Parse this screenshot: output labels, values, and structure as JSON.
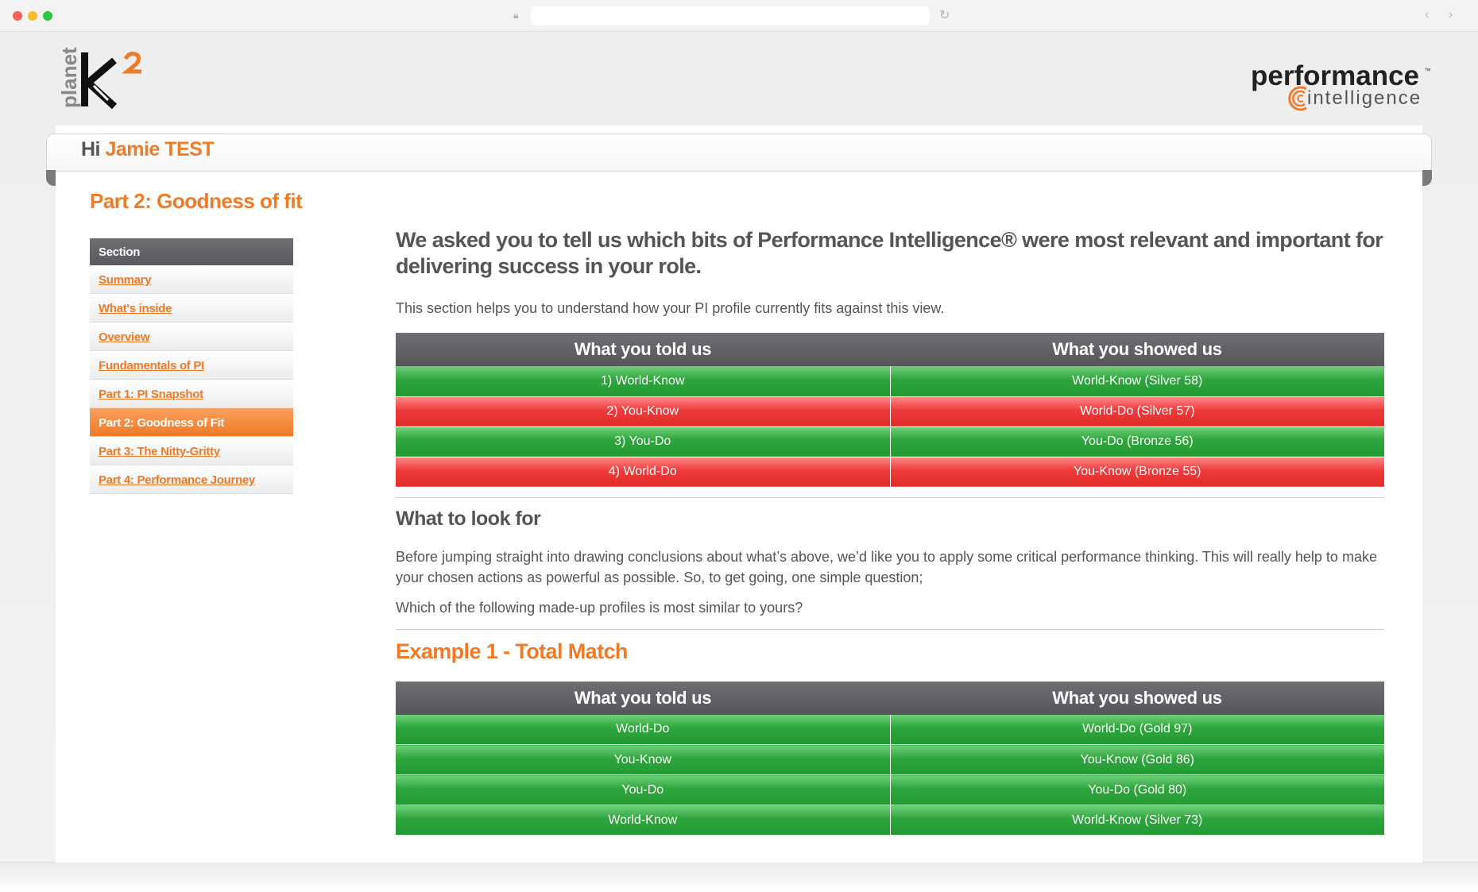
{
  "browser": {},
  "header": {
    "logo_text": "planet",
    "brand_right_1": "performance",
    "brand_right_tm": "™",
    "brand_right_2": "intelligence"
  },
  "greeting": {
    "hi": "Hi",
    "name": "Jamie TEST"
  },
  "page_title": "Part 2: Goodness of fit",
  "sidebar": {
    "heading": "Section",
    "items": [
      {
        "label": "Summary"
      },
      {
        "label": "What's inside"
      },
      {
        "label": "Overview"
      },
      {
        "label": "Fundamentals of PI"
      },
      {
        "label": "Part 1: PI Snapshot"
      },
      {
        "label": "Part 2: Goodness of Fit"
      },
      {
        "label": "Part 3: The Nitty-Gritty"
      },
      {
        "label": "Part 4: Performance Journey"
      }
    ],
    "active_index": 5
  },
  "main": {
    "lead": "We asked you to tell us which bits of Performance Intelligence® were most relevant and important for delivering success in your role.",
    "intro": "This section helps you to understand how your PI profile currently fits against this view.",
    "table1": {
      "col1": "What you told us",
      "col2": "What you showed us",
      "rows": [
        {
          "told": "1) World-Know",
          "showed": "World-Know (Silver 58)",
          "status": "green"
        },
        {
          "told": "2) You-Know",
          "showed": "World-Do (Silver 57)",
          "status": "red"
        },
        {
          "told": "3) You-Do",
          "showed": "You-Do (Bronze 56)",
          "status": "green"
        },
        {
          "told": "4) World-Do",
          "showed": "You-Know (Bronze 55)",
          "status": "red"
        }
      ]
    },
    "look_for_title": "What to look for",
    "look_for_para": "Before jumping straight into drawing conclusions about what’s above, we’d like you to apply some critical performance thinking. This will really help to make your chosen actions as powerful as possible. So, to get going, one simple question;",
    "question": "Which of the following made-up profiles is most similar to yours?",
    "example1_title": "Example 1 - Total Match",
    "table2": {
      "col1": "What you told us",
      "col2": "What you showed us",
      "rows": [
        {
          "told": "World-Do",
          "showed": "World-Do (Gold 97)",
          "status": "green"
        },
        {
          "told": "You-Know",
          "showed": "You-Know (Gold 86)",
          "status": "green"
        },
        {
          "told": "You-Do",
          "showed": "You-Do (Gold 80)",
          "status": "green"
        },
        {
          "told": "World-Know",
          "showed": "World-Know (Silver 73)",
          "status": "green"
        }
      ]
    }
  },
  "colors": {
    "accent": "#f07a26",
    "header_gray": "#5f5f64",
    "match_green": "#2ea43c",
    "mismatch_red": "#e12a2a"
  },
  "icons": [
    "lock-icon",
    "reload-icon",
    "back-icon",
    "forward-icon"
  ]
}
